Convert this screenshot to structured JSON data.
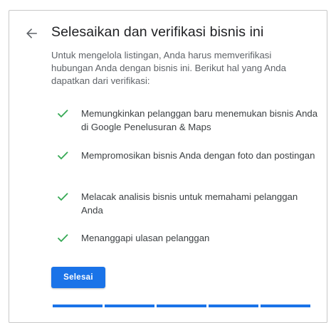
{
  "header": {
    "title": "Selesaikan dan verifikasi bisnis ini",
    "back_icon": "arrow-left-icon"
  },
  "intro": "Untuk mengelola listingan, Anda harus memverifikasi hubungan Anda dengan bisnis ini. Berikut hal yang Anda dapatkan dari verifikasi:",
  "benefits": [
    {
      "icon": "check-icon",
      "text": "Memungkinkan pelanggan baru menemukan bisnis Anda di Google Penelusuran & Maps"
    },
    {
      "icon": "check-icon",
      "text": "Mempromosikan bisnis Anda dengan foto dan postingan"
    },
    {
      "icon": "check-icon",
      "text": "Melacak analisis bisnis untuk memahami pelanggan Anda"
    },
    {
      "icon": "check-icon",
      "text": "Menanggapi ulasan pelanggan"
    }
  ],
  "done_button": {
    "label": "Selesai"
  },
  "progress": {
    "completed_steps": 5,
    "total_steps": 5
  },
  "colors": {
    "accent": "#1a73e8",
    "check": "#34a853",
    "title_text": "#202124",
    "body_text": "#5f6368"
  }
}
